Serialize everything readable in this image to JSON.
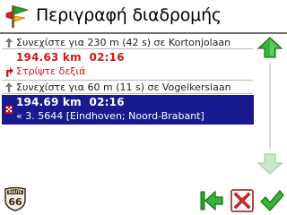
{
  "window": {
    "title": "Περιγραφή διαδρομής"
  },
  "route_list": [
    {
      "kind": "instruction",
      "text": "Συνεχίστε για 230 m (42 s) σε Kortonjolaan",
      "icon": "straight-arrow-icon"
    },
    {
      "kind": "waypoint",
      "distance": "194.63 km",
      "time": "02:16",
      "instruction": "Στρίψτε δεξιά",
      "icon": "turn-right-icon"
    },
    {
      "kind": "instruction",
      "text": "Συνεχίστε για 60 m (11 s) σε Vogelkerslaan",
      "icon": "straight-arrow-icon"
    },
    {
      "kind": "destination",
      "distance": "194.69 km",
      "time": "02:16",
      "detail": "« 3.  5644 [Eindhoven; Noord-Brabant]",
      "icon": "destination-flag-icon",
      "selected": true
    }
  ],
  "logo": {
    "top_text": "ROUTE",
    "number": "66"
  },
  "colors": {
    "accent_red": "#d21a1a",
    "selection_blue": "#1a1a90",
    "scroll_green": "#2aa52a"
  }
}
